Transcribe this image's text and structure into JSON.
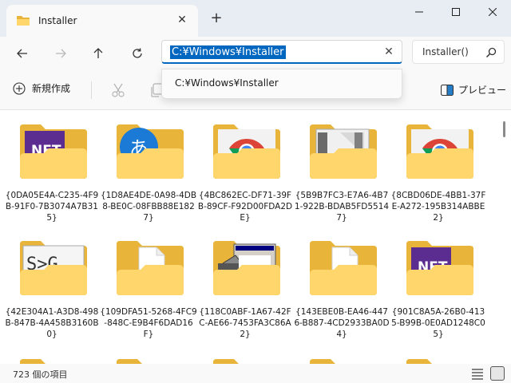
{
  "window": {
    "tab_title": "Installer",
    "new_tab": "+"
  },
  "nav": {
    "address": "C:¥Windows¥Installer",
    "search_text": "Installer()"
  },
  "dropdown": {
    "suggestion": "C:¥Windows¥Installer"
  },
  "commandbar": {
    "new_label": "新規作成",
    "preview_label": "プレビュー"
  },
  "folders": [
    {
      "name": "{0DA05E4A-C235-4F9B-91F0-7B3074A7B315}",
      "icon": "dotnet-icon"
    },
    {
      "name": "{1D8AE4DE-0A98-4DB8-BE0C-08FBB88E1827}",
      "icon": "japanese-input-icon"
    },
    {
      "name": "{4BC862EC-DF71-39FB-89CF-F92D00FDA2DE}",
      "icon": "chrome-icon"
    },
    {
      "name": "{5B9B7FC3-E7A6-4B71-922B-BDAB5FD55147}",
      "icon": "window-icon"
    },
    {
      "name": "{8CBD06DE-4BB1-37FE-A272-195B314ABBE2}",
      "icon": "chrome-icon"
    },
    {
      "name": "{42E304A1-A3D8-498B-847B-4A458B3160B0}",
      "icon": "sxs-icon"
    },
    {
      "name": "{109DFA51-5268-4FC9-848C-E9B4F6DAD16F}",
      "icon": "document-icon"
    },
    {
      "name": "{118C0ABF-1A67-42FC-AE66-7453FA3C86A2}",
      "icon": "installer-icon"
    },
    {
      "name": "{143EBE0B-EA46-4476-B887-4CD2933BA0D4}",
      "icon": "document-icon"
    },
    {
      "name": "{901C8A5A-26B0-4135-B99B-0E0AD1248C05}",
      "icon": "dotnet-icon"
    }
  ],
  "status": {
    "item_count": "723 個の項目"
  },
  "colors": {
    "accent": "#0067c0",
    "folder_back": "#e9b43a",
    "folder_front": "#ffd66b",
    "dotnet": "#5c2d91"
  }
}
